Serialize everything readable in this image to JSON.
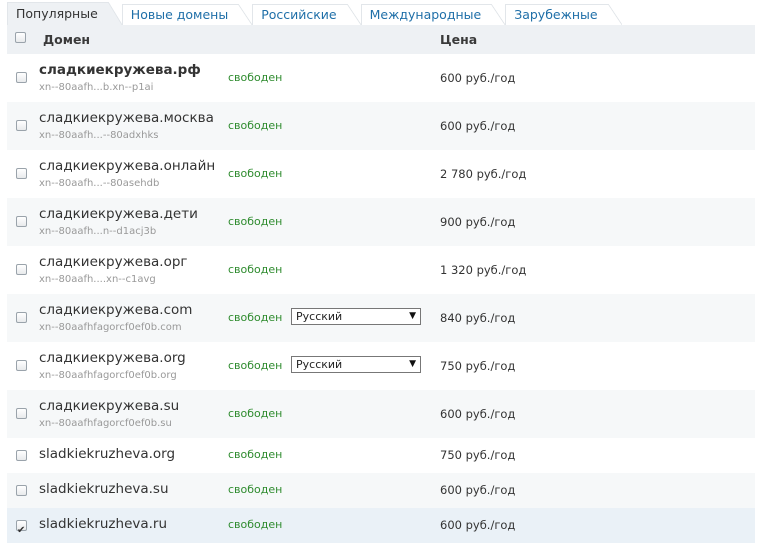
{
  "tabs": [
    {
      "label": "Популярные",
      "active": true
    },
    {
      "label": "Новые домены",
      "active": false
    },
    {
      "label": "Российские",
      "active": false
    },
    {
      "label": "Международные",
      "active": false
    },
    {
      "label": "Зарубежные",
      "active": false
    }
  ],
  "table": {
    "col_domain": "Домен",
    "col_price": "Цена",
    "rows": [
      {
        "name": "сладкиекружева.рф",
        "punycode": "xn--80aafh...b.xn--p1ai",
        "status": "свободен",
        "price": "600 руб./год",
        "checked": false
      },
      {
        "name": "сладкиекружева.москва",
        "punycode": "xn--80aafh...--80adxhks",
        "status": "свободен",
        "price": "600 руб./год",
        "checked": false
      },
      {
        "name": "сладкиекружева.онлайн",
        "punycode": "xn--80aafh...--80asehdb",
        "status": "свободен",
        "price": "2 780 руб./год",
        "checked": false
      },
      {
        "name": "сладкиекружева.дети",
        "punycode": "xn--80aafh...n--d1acj3b",
        "status": "свободен",
        "price": "900 руб./год",
        "checked": false
      },
      {
        "name": "сладкиекружева.орг",
        "punycode": "xn--80aafh....xn--c1avg",
        "status": "свободен",
        "price": "1 320 руб./год",
        "checked": false
      },
      {
        "name": "сладкиекружева.com",
        "punycode": "xn--80aafhfagorcf0ef0b.com",
        "status": "свободен",
        "select": "Русский",
        "price": "840 руб./год",
        "checked": false
      },
      {
        "name": "сладкиекружева.org",
        "punycode": "xn--80aafhfagorcf0ef0b.org",
        "status": "свободен",
        "select": "Русский",
        "price": "750 руб./год",
        "checked": false
      },
      {
        "name": "сладкиекружева.su",
        "punycode": "xn--80aafhfagorcf0ef0b.su",
        "status": "свободен",
        "price": "600 руб./год",
        "checked": false
      },
      {
        "name": "sladkiekruzheva.org",
        "status": "свободен",
        "price": "750 руб./год",
        "checked": false
      },
      {
        "name": "sladkiekruzheva.su",
        "status": "свободен",
        "price": "600 руб./год",
        "checked": false
      },
      {
        "name": "sladkiekruzheva.ru",
        "status": "свободен",
        "price": "600 руб./год",
        "checked": true
      }
    ]
  },
  "colors": {
    "link": "#1f6fa8",
    "status_free": "#2e8b2e",
    "header_bg": "#eef1f4",
    "row_alt": "#f6f8f9",
    "row_selected": "#eaf1f7"
  },
  "icons": {
    "checkbox": "checkbox-icon",
    "dropdown": "chevron-down-icon"
  }
}
